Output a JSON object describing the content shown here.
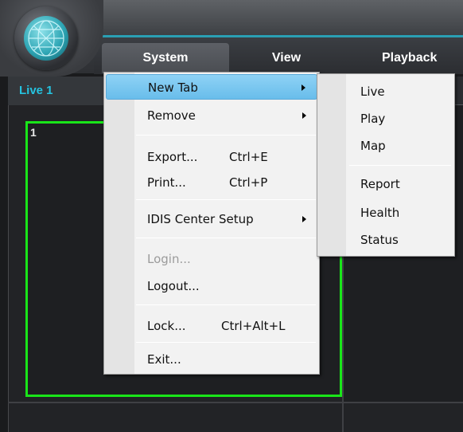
{
  "menubar": {
    "items": [
      "System",
      "View",
      "Playback"
    ]
  },
  "tabs": {
    "active": "Live 1"
  },
  "camera_cells": {
    "cell1_label": "1"
  },
  "system_menu": {
    "items": [
      {
        "label": "New Tab",
        "shortcut": "",
        "submenu": true,
        "highlighted": true,
        "disabled": false
      },
      {
        "label": "Remove",
        "shortcut": "",
        "submenu": true,
        "highlighted": false,
        "disabled": false
      },
      {
        "label": "Export...",
        "shortcut": "Ctrl+E",
        "submenu": false,
        "highlighted": false,
        "disabled": false
      },
      {
        "label": "Print...",
        "shortcut": "Ctrl+P",
        "submenu": false,
        "highlighted": false,
        "disabled": false
      },
      {
        "label": "IDIS Center Setup",
        "shortcut": "",
        "submenu": true,
        "highlighted": false,
        "disabled": false
      },
      {
        "label": "Login...",
        "shortcut": "",
        "submenu": false,
        "highlighted": false,
        "disabled": true
      },
      {
        "label": "Logout...",
        "shortcut": "",
        "submenu": false,
        "highlighted": false,
        "disabled": false
      },
      {
        "label": "Lock...",
        "shortcut": "Ctrl+Alt+L",
        "submenu": false,
        "highlighted": false,
        "disabled": false
      },
      {
        "label": "Exit...",
        "shortcut": "",
        "submenu": false,
        "highlighted": false,
        "disabled": false
      }
    ]
  },
  "newtab_submenu": {
    "items": [
      "Live",
      "Play",
      "Map",
      "Report",
      "Health",
      "Status"
    ]
  },
  "colors": {
    "accent": "#2a9fb3",
    "active_tab_text": "#25c3e0",
    "selected_cell_border": "#19e519",
    "menu_highlight": "#69bdeb"
  },
  "icons": {
    "logo": "globe-logo-icon",
    "submenu_arrow": "chevron-right-icon"
  }
}
